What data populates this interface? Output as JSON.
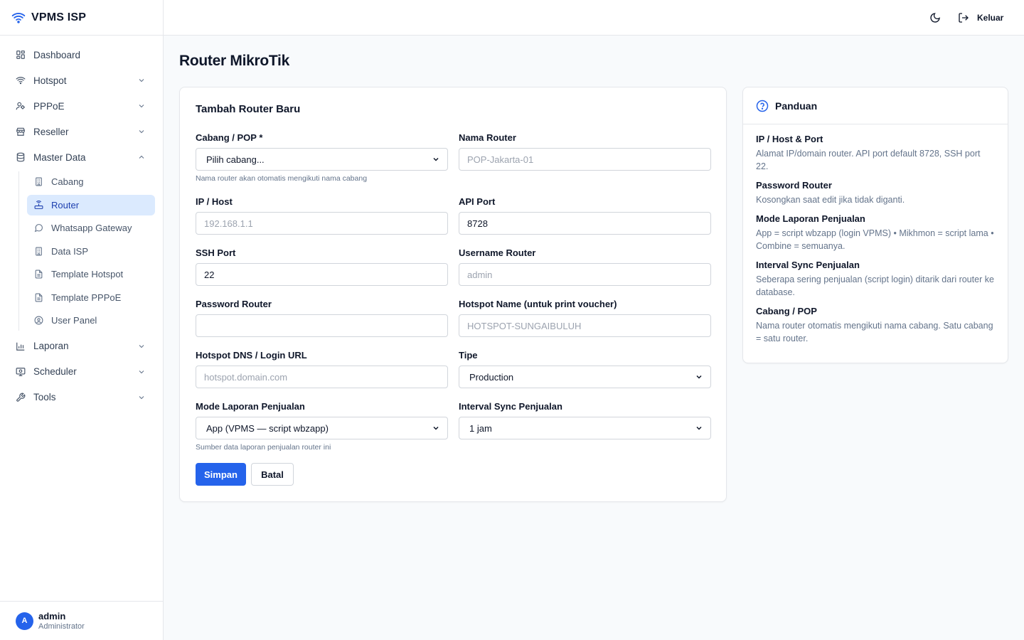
{
  "brand": {
    "name": "VPMS ISP",
    "icon": "wifi-icon"
  },
  "sidebar": {
    "items": [
      {
        "label": "Dashboard",
        "icon": "grid-icon"
      },
      {
        "label": "Hotspot",
        "icon": "wifi-icon",
        "expandable": true
      },
      {
        "label": "PPPoE",
        "icon": "users-icon",
        "expandable": true
      },
      {
        "label": "Reseller",
        "icon": "store-icon",
        "expandable": true
      },
      {
        "label": "Master Data",
        "icon": "database-icon",
        "expanded": true
      }
    ],
    "master_data_sub": [
      {
        "label": "Cabang",
        "icon": "building-icon"
      },
      {
        "label": "Router",
        "icon": "router-icon",
        "active": true
      },
      {
        "label": "Whatsapp Gateway",
        "icon": "chat-icon"
      },
      {
        "label": "Data ISP",
        "icon": "building-icon"
      },
      {
        "label": "Template Hotspot",
        "icon": "file-icon"
      },
      {
        "label": "Template PPPoE",
        "icon": "file-icon"
      },
      {
        "label": "User Panel",
        "icon": "user-circle-icon"
      }
    ],
    "items_after": [
      {
        "label": "Laporan",
        "icon": "chart-icon",
        "expandable": true
      },
      {
        "label": "Scheduler",
        "icon": "monitor-icon",
        "expandable": true
      },
      {
        "label": "Tools",
        "icon": "wrench-icon",
        "expandable": true
      }
    ],
    "user": {
      "initial": "A",
      "name": "admin",
      "role": "Administrator"
    }
  },
  "topbar": {
    "logout_label": "Keluar"
  },
  "page": {
    "title": "Router MikroTik"
  },
  "form": {
    "title": "Tambah Router Baru",
    "cabang": {
      "label": "Cabang / POP *",
      "value": "Pilih cabang...",
      "hint": "Nama router akan otomatis mengikuti nama cabang"
    },
    "nama_router": {
      "label": "Nama Router",
      "placeholder": "POP-Jakarta-01"
    },
    "ip_host": {
      "label": "IP / Host",
      "placeholder": "192.168.1.1"
    },
    "api_port": {
      "label": "API Port",
      "value": "8728"
    },
    "ssh_port": {
      "label": "SSH Port",
      "value": "22"
    },
    "username": {
      "label": "Username Router",
      "placeholder": "admin"
    },
    "password": {
      "label": "Password Router",
      "value": ""
    },
    "hotspot_name": {
      "label": "Hotspot Name (untuk print voucher)",
      "placeholder": "HOTSPOT-SUNGAIBULUH"
    },
    "hotspot_dns": {
      "label": "Hotspot DNS / Login URL",
      "placeholder": "hotspot.domain.com"
    },
    "tipe": {
      "label": "Tipe",
      "value": "Production"
    },
    "mode_laporan": {
      "label": "Mode Laporan Penjualan",
      "value": "App (VPMS — script wbzapp)",
      "hint": "Sumber data laporan penjualan router ini"
    },
    "interval_sync": {
      "label": "Interval Sync Penjualan",
      "value": "1 jam"
    },
    "save_label": "Simpan",
    "cancel_label": "Batal"
  },
  "guide": {
    "title": "Panduan",
    "items": [
      {
        "title": "IP / Host & Port",
        "desc": "Alamat IP/domain router. API port default 8728, SSH port 22."
      },
      {
        "title": "Password Router",
        "desc": "Kosongkan saat edit jika tidak diganti."
      },
      {
        "title": "Mode Laporan Penjualan",
        "desc": "App = script wbzapp (login VPMS) • Mikhmon = script lama • Combine = semuanya."
      },
      {
        "title": "Interval Sync Penjualan",
        "desc": "Seberapa sering penjualan (script login) ditarik dari router ke database."
      },
      {
        "title": "Cabang / POP",
        "desc": "Nama router otomatis mengikuti nama cabang. Satu cabang = satu router."
      }
    ]
  },
  "colors": {
    "accent": "#2563eb",
    "active_bg": "#dbeafe",
    "active_text": "#1e40af"
  }
}
